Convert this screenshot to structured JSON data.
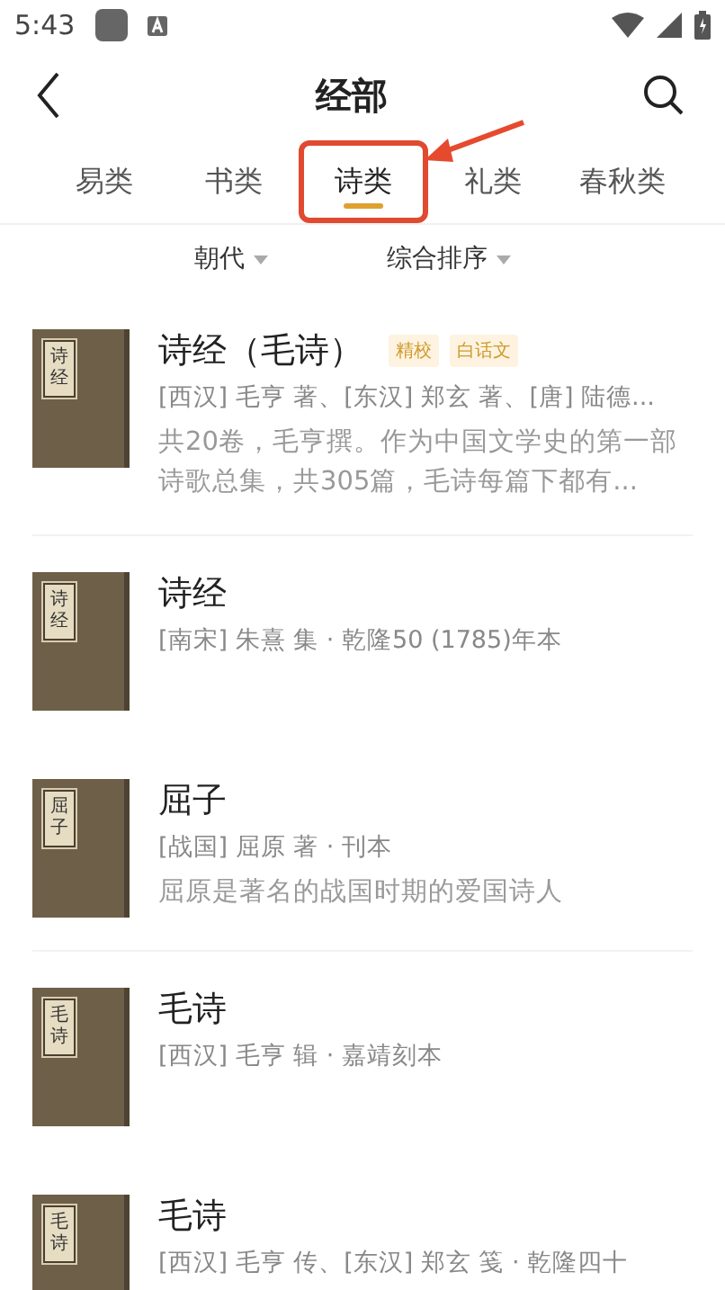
{
  "status_bar": {
    "time": "5:43"
  },
  "header": {
    "title": "经部"
  },
  "tabs": [
    {
      "label": "易类",
      "selected": false,
      "highlighted": false
    },
    {
      "label": "书类",
      "selected": false,
      "highlighted": false
    },
    {
      "label": "诗类",
      "selected": true,
      "highlighted": true
    },
    {
      "label": "礼类",
      "selected": false,
      "highlighted": false
    },
    {
      "label": "春秋类",
      "selected": false,
      "highlighted": false
    }
  ],
  "filters": [
    {
      "label": "朝代"
    },
    {
      "label": "综合排序"
    }
  ],
  "books": [
    {
      "cover_title": "诗经",
      "title": "诗经（毛诗）",
      "tags": [
        "精校",
        "白话文"
      ],
      "authors": "[西汉] 毛亨 著、[东汉] 郑玄 著、[唐] 陆德...",
      "description": "共20卷，毛亨撰。作为中国文学史的第一部诗歌总集，共305篇，毛诗每篇下都有..."
    },
    {
      "cover_title": "诗经",
      "title": "诗经",
      "authors": "[南宋] 朱熹 集 · 乾隆50 (1785)年本"
    },
    {
      "cover_title": "屈子",
      "title": "屈子",
      "authors": "[战国] 屈原 著 · 刊本",
      "description": "屈原是著名的战国时期的爱国诗人"
    },
    {
      "cover_title": "毛诗",
      "title": "毛诗",
      "authors": "[西汉] 毛亨 辑 · 嘉靖刻本"
    },
    {
      "cover_title": "毛诗",
      "title": "毛诗",
      "authors": "[西汉] 毛亨 传、[东汉] 郑玄 笺 · 乾隆四十"
    }
  ]
}
